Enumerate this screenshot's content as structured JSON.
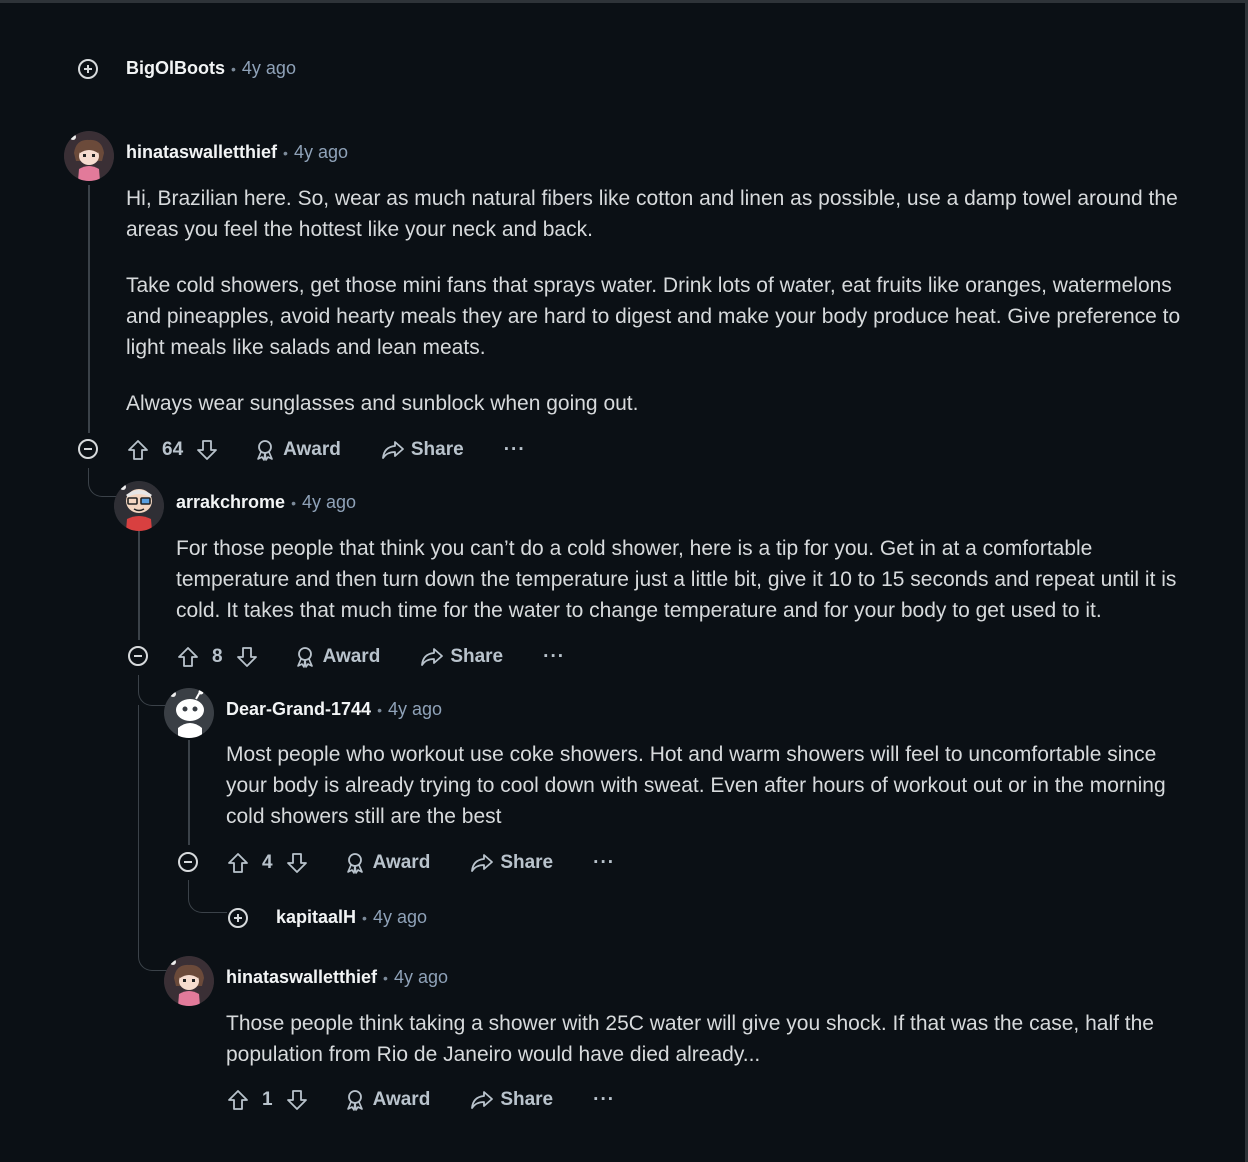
{
  "comments": {
    "c1": {
      "user": "BigOlBoots",
      "time": "4y ago"
    },
    "c2": {
      "user": "hinataswalletthief",
      "time": "4y ago",
      "paragraphs": [
        "Hi, Brazilian here. So, wear as much natural fibers like cotton and linen as possible, use a damp towel around the areas you feel the hottest like your neck and back.",
        "Take cold showers, get those mini fans that sprays water. Drink lots of water, eat fruits like oranges, watermelons and pineapples, avoid hearty meals they are hard to digest and make your body produce heat. Give preference to light meals like salads and lean meats.",
        "Always wear sunglasses and sunblock when going out."
      ],
      "votes": "64"
    },
    "c3": {
      "user": "arrakchrome",
      "time": "4y ago",
      "paragraphs": [
        "For those people that think you can’t do a cold shower, here is a tip for you. Get in at a comfortable temperature and then turn down the temperature just a little bit, give it 10 to 15 seconds and repeat until it is cold. It takes that much time for the water to change temperature and for your body to get used to it."
      ],
      "votes": "8"
    },
    "c4": {
      "user": "Dear-Grand-1744",
      "time": "4y ago",
      "paragraphs": [
        "Most people who workout use coke showers. Hot and warm showers will feel to uncomfortable since your body is already trying to cool down with sweat. Even after hours of workout out or in the morning cold showers still are the best"
      ],
      "votes": "4"
    },
    "c5": {
      "user": "kapitaalH",
      "time": "4y ago"
    },
    "c6": {
      "user": "hinataswalletthief",
      "time": "4y ago",
      "paragraphs": [
        "Those people think taking a shower with 25C water will give you shock. If that was the case, half the population from Rio de Janeiro would have died already..."
      ],
      "votes": "1"
    }
  },
  "labels": {
    "award": "Award",
    "share": "Share",
    "more": "···",
    "sep": "•"
  },
  "icons": [
    "upvote-icon",
    "downvote-icon",
    "award-icon",
    "share-icon",
    "expand-icon",
    "collapse-icon"
  ],
  "colors": {
    "background": "#0b1015",
    "text": "#d7dadc",
    "muted": "#8fa2b8"
  }
}
